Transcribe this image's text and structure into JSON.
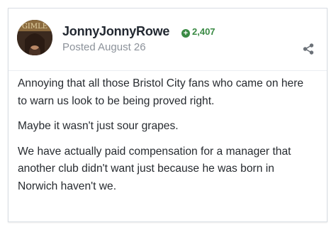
{
  "post": {
    "author": "JonnyJonnyRowe",
    "reputation": "2,407",
    "posted": "Posted August 26",
    "avatar_text": "GIMLE",
    "paragraphs": [
      "Annoying that all those Bristol City fans who came on here\nto warn us look to be being proved right.",
      "Maybe it wasn't just sour grapes.",
      "We have actually paid compensation for a manager that\nanother club didn't want just because he was born in\nNorwich haven't we."
    ]
  },
  "icons": {
    "reputation": "plus-circle-icon",
    "share": "share-icon"
  },
  "colors": {
    "reputation": "#3a8a44",
    "author": "#222831",
    "muted": "#8c929a",
    "border": "#d8dde3"
  }
}
